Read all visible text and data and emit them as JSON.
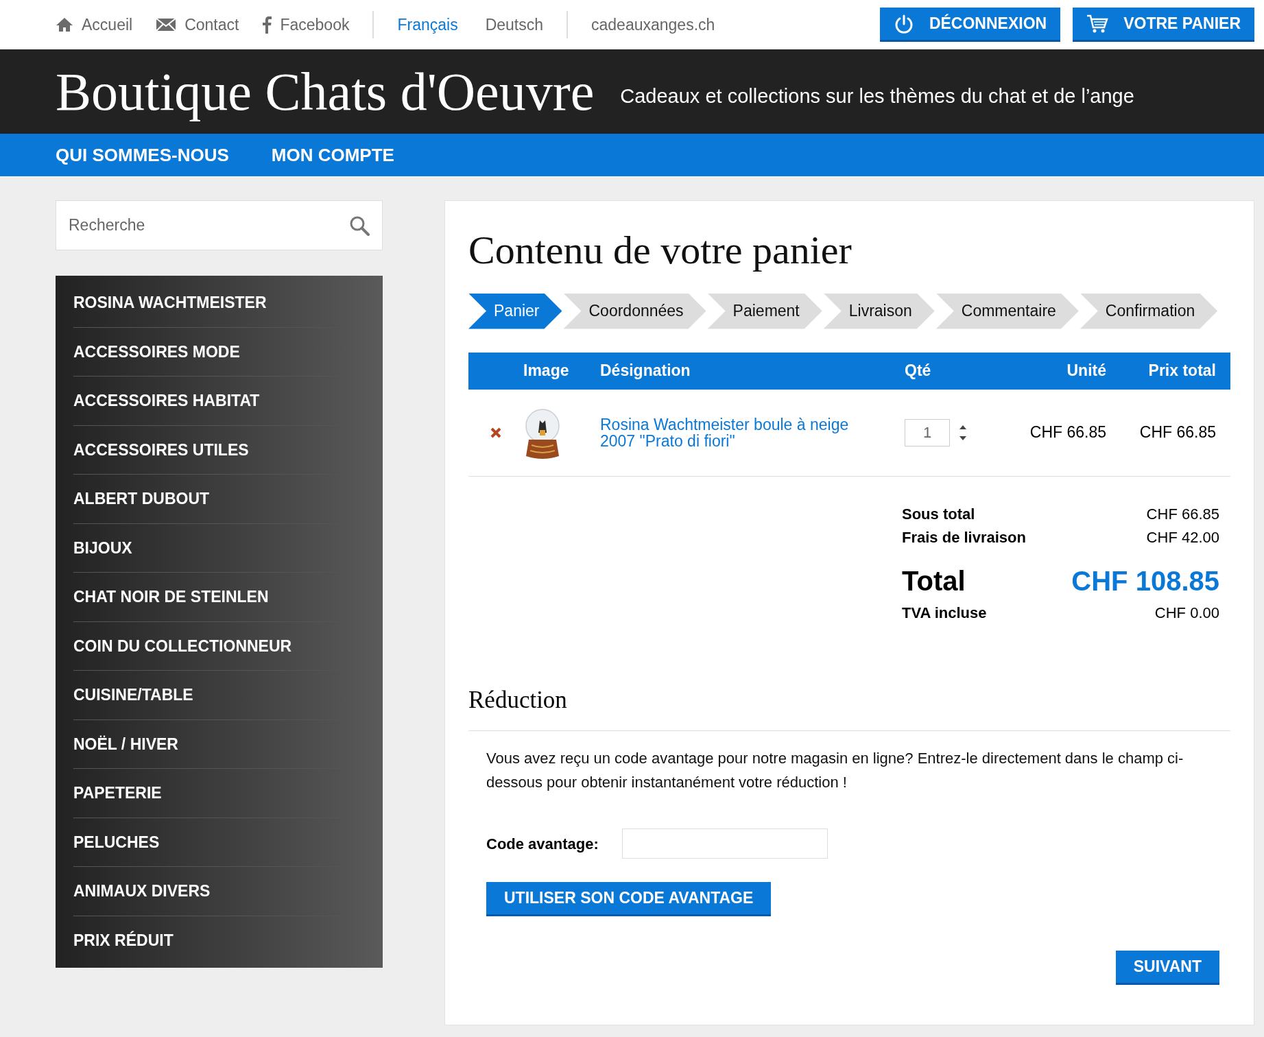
{
  "top_links": [
    {
      "kind": "home",
      "label": "Accueil"
    },
    {
      "kind": "mail",
      "label": "Contact"
    },
    {
      "kind": "facebook",
      "label": "Facebook"
    }
  ],
  "languages": [
    {
      "label": "Français",
      "selected": true
    },
    {
      "label": "Deutsch",
      "selected": false
    }
  ],
  "site_link": "cadeauxanges.ch",
  "top_buttons": [
    {
      "kind": "power",
      "label": "DÉCONNEXION"
    },
    {
      "kind": "cart",
      "label": "VOTRE PANIER"
    }
  ],
  "header": {
    "title": "Boutique Chats d'Oeuvre",
    "tagline": "Cadeaux et collections sur les thèmes du chat et de l’ange"
  },
  "nav": [
    "QUI SOMMES-NOUS",
    "MON COMPTE"
  ],
  "search": {
    "placeholder": "Recherche"
  },
  "categories": [
    "ROSINA WACHTMEISTER",
    "ACCESSOIRES MODE",
    "ACCESSOIRES HABITAT",
    "ACCESSOIRES UTILES",
    "ALBERT DUBOUT",
    "BIJOUX",
    "CHAT NOIR DE STEINLEN",
    "COIN DU COLLECTIONNEUR",
    "CUISINE/TABLE",
    "NOËL / HIVER",
    "PAPETERIE",
    "PELUCHES",
    "ANIMAUX DIVERS",
    "PRIX RÉDUIT"
  ],
  "page_title": "Contenu de votre panier",
  "steps": [
    {
      "label": "Panier",
      "selected": true
    },
    {
      "label": "Coordonnées",
      "selected": false
    },
    {
      "label": "Paiement",
      "selected": false
    },
    {
      "label": "Livraison",
      "selected": false
    },
    {
      "label": "Commentaire",
      "selected": false
    },
    {
      "label": "Confirmation",
      "selected": false
    }
  ],
  "table": {
    "columns": [
      "Image",
      "Désignation",
      "Qté",
      "Unité",
      "Prix total"
    ],
    "rows": [
      {
        "designation": "Rosina Wachtmeister boule à neige 2007 \"Prato di fiori\"",
        "quantity": "1",
        "unit": "CHF 66.85",
        "total": "CHF 66.85"
      }
    ]
  },
  "totals": [
    {
      "label": "Sous total",
      "value": "CHF 66.85"
    },
    {
      "label": "Frais de livraison",
      "value": "CHF 42.00"
    }
  ],
  "grand_total": {
    "label": "Total",
    "value": "CHF 108.85"
  },
  "vat": {
    "label": "TVA incluse",
    "value": "CHF 0.00"
  },
  "reduction": {
    "title": "Réduction",
    "text": "Vous avez reçu un code avantage pour notre magasin en ligne? Entrez-le directement dans le champ ci-dessous pour obtenir instantanément votre réduction !",
    "field_label": "Code avantage:",
    "button": "UTILISER SON CODE AVANTAGE"
  },
  "next_button": "SUIVANT"
}
